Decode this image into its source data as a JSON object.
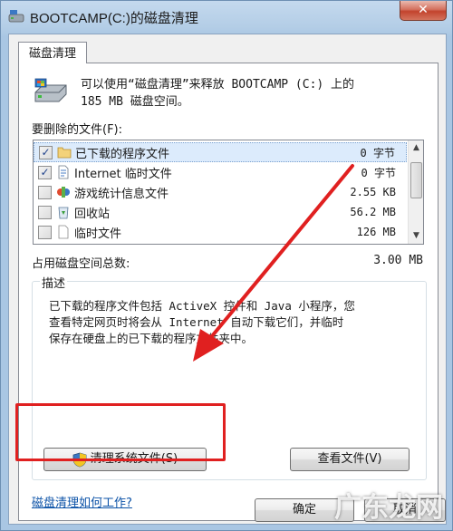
{
  "window": {
    "title": "BOOTCAMP(C:)的磁盘清理",
    "close_label": "✕"
  },
  "tab": {
    "label": "磁盘清理"
  },
  "summary": {
    "line1": "可以使用“磁盘清理”来释放 BOOTCAMP (C:) 上的",
    "line2": "185 MB 磁盘空间。"
  },
  "files": {
    "label": "要删除的文件(F):",
    "items": [
      {
        "name": "已下载的程序文件",
        "size": "0 字节",
        "checked": true,
        "icon": "folder-icon"
      },
      {
        "name": "Internet 临时文件",
        "size": "0 字节",
        "checked": true,
        "icon": "document-icon"
      },
      {
        "name": "游戏统计信息文件",
        "size": "2.55 KB",
        "checked": false,
        "icon": "games-icon"
      },
      {
        "name": "回收站",
        "size": "56.2 MB",
        "checked": false,
        "icon": "recycle-bin-icon"
      },
      {
        "name": "临时文件",
        "size": "126 MB",
        "checked": false,
        "icon": "file-icon"
      }
    ]
  },
  "total": {
    "label": "占用磁盘空间总数:",
    "value": "3.00 MB"
  },
  "description": {
    "title": "描述",
    "text_line1": "已下载的程序文件包括 ActiveX 控件和 Java 小程序，您",
    "text_line2": "查看特定网页时将会从 Internet 自动下载它们，并临时",
    "text_line3": "保存在硬盘上的已下载的程序文件夹中。"
  },
  "buttons": {
    "clean_system": "清理系统文件(S)",
    "view_files": "查看文件(V)",
    "ok": "确定",
    "cancel": "取消"
  },
  "help_link": "磁盘清理如何工作?",
  "watermark": "广东龙网",
  "colors": {
    "annotation_red": "#e02020",
    "link_blue": "#0b52a7"
  }
}
